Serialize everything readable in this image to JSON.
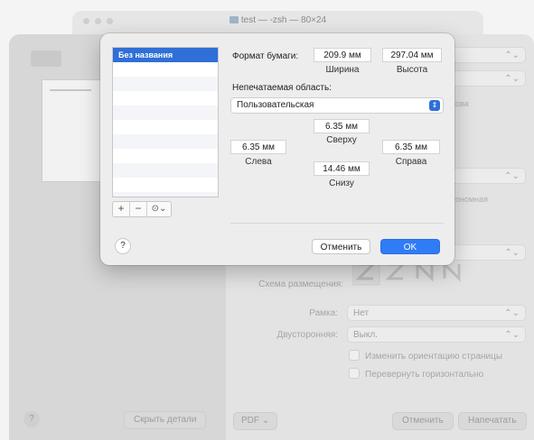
{
  "terminal": {
    "title": "test — -zsh — 80×24"
  },
  "page_setup": {
    "paper_sizes": [
      "Без названия"
    ],
    "list_controls": {
      "add": "+",
      "remove": "−",
      "gear": "⊙⌄"
    },
    "paper_format_label": "Формат бумаги:",
    "width_value": "209.9 мм",
    "width_label": "Ширина",
    "height_value": "297.04 мм",
    "height_label": "Высота",
    "nonprintable_label": "Непечатаемая область:",
    "nonprintable_value": "Пользовательская",
    "top_value": "6.35 мм",
    "top_label": "Сверху",
    "left_value": "6.35 мм",
    "left_label": "Слева",
    "right_value": "6.35 мм",
    "right_label": "Справа",
    "bottom_value": "14.46 мм",
    "bottom_label": "Снизу",
    "help": "?",
    "cancel": "Отменить",
    "ok": "OK"
  },
  "print_dialog": {
    "layout_scheme_label": "Схема размещения:",
    "border_label": "Рамка:",
    "border_value": "Нет",
    "duplex_label": "Двусторонняя:",
    "duplex_value": "Выкл.",
    "change_orientation": "Изменить ориентацию страницы",
    "flip_horizontal": "Перевернуть горизонтально",
    "partial_text_1": "ова",
    "partial_text_2": "ономная",
    "help": "?",
    "hide_details": "Скрыть детали",
    "pdf": "PDF",
    "cancel": "Отменить",
    "print": "Напечатать"
  }
}
